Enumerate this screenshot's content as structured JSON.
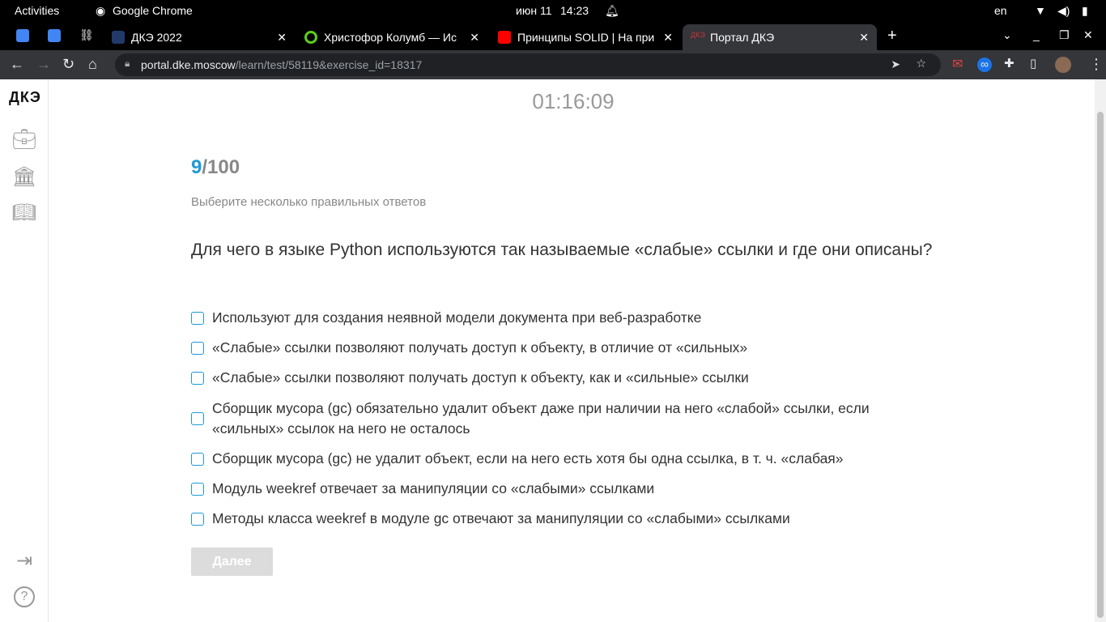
{
  "system": {
    "activities": "Activities",
    "app": "Google Chrome",
    "date": "июн 11",
    "time": "14:23",
    "lang": "en"
  },
  "tabs": [
    {
      "label": "ДКЭ 2022"
    },
    {
      "label": "Христофор Колумб — Ис"
    },
    {
      "label": "Принципы SOLID | На при"
    },
    {
      "label": "Портал ДКЭ",
      "active": true
    }
  ],
  "address": {
    "host": "portal.dke.moscow",
    "path": "/learn/test/58119&exercise_id=18317"
  },
  "sidebar": {
    "logo": "ДКЭ",
    "items": [
      "briefcase-icon",
      "museum-icon",
      "book-icon",
      "logout-icon",
      "help-icon"
    ]
  },
  "test": {
    "timer": "01:16:09",
    "current": "9",
    "total": "/100",
    "hint": "Выберите несколько правильных ответов",
    "question": "Для чего в языке Python используются так называемые «слабые» ссылки и где они описаны?",
    "options": [
      "Используют для создания неявной модели документа при веб-разработке",
      "«Слабые» ссылки позволяют получать доступ к объекту, в отличие от «сильных»",
      "«Слабые» ссылки позволяют получать доступ к объекту, как и «сильные» ссылки",
      "Сборщик мусора (gc) обязательно удалит объект даже при наличии на него «слабой» ссылки, если «сильных» ссылок на него не осталось",
      "Сборщик мусора (gc) не удалит объект, если на него есть хотя бы одна ссылка, в т. ч. «слабая»",
      "Модуль weekref отвечает за манипуляции со «слабыми» ссылками",
      "Методы класса weekref в модуле gc отвечают за манипуляции со «слабыми» ссылками"
    ],
    "next": "Далее"
  },
  "colors": {
    "accent": "#1e9ad6"
  }
}
